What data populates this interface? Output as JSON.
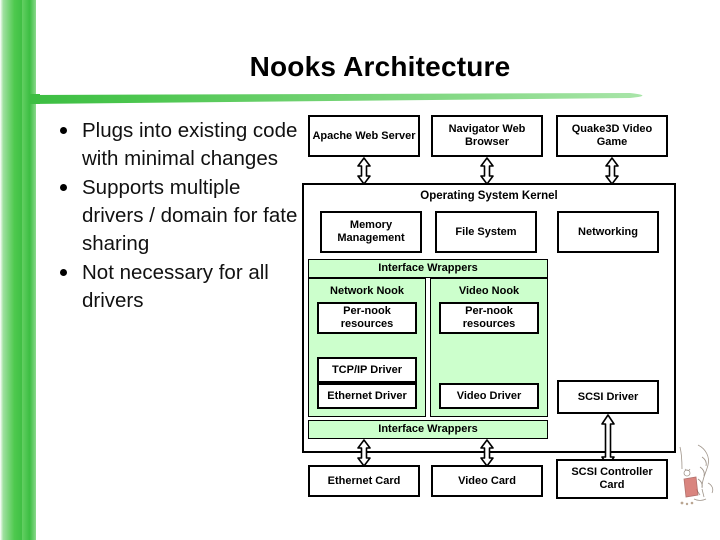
{
  "slide": {
    "title": "Nooks Architecture",
    "bullets": [
      "Plugs into existing code with minimal changes",
      "Supports multiple drivers / domain for fate sharing",
      "Not necessary for all drivers"
    ]
  },
  "theme": {
    "accent_green": "#3cbe42",
    "panel_green": "#ccffcc",
    "text_color": "#000000",
    "background": "#ffffff"
  },
  "diagram": {
    "applications": [
      {
        "label": "Apache Web Server"
      },
      {
        "label": "Navigator Web Browser"
      },
      {
        "label": "Quake3D Video Game"
      }
    ],
    "kernel": {
      "title": "Operating System Kernel",
      "subsystems": [
        {
          "label": "Memory Management"
        },
        {
          "label": "File System"
        },
        {
          "label": "Networking"
        }
      ],
      "wrapper_top": "Interface Wrappers",
      "wrapper_bottom": "Interface Wrappers",
      "nooks": [
        {
          "name": "Network Nook",
          "resources": "Per-nook resources",
          "drivers": [
            "TCP/IP Driver",
            "Ethernet Driver"
          ]
        },
        {
          "name": "Video Nook",
          "resources": "Per-nook resources",
          "drivers": [
            "Video Driver"
          ]
        }
      ],
      "unprotected_driver": "SCSI Driver"
    },
    "hardware": [
      {
        "label": "Ethernet Card"
      },
      {
        "label": "Video Card"
      },
      {
        "label": "SCSI Controller Card"
      }
    ]
  }
}
